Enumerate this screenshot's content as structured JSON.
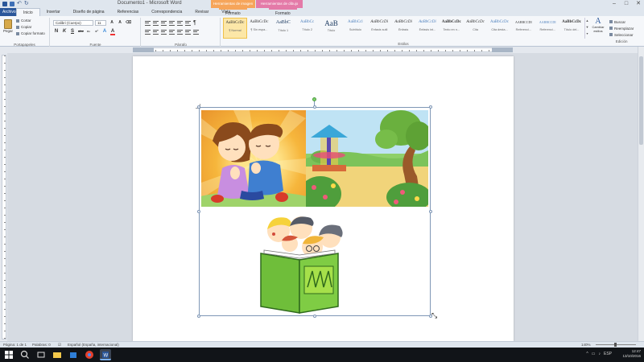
{
  "window": {
    "title": "Documento1 - Microsoft Word",
    "context_picture_tools": "Herramientas de imagen",
    "context_drawing_tools": "Herramientas de dibujo",
    "minimize": "–",
    "maximize": "□",
    "close": "✕"
  },
  "ribbon_tabs": [
    "Archivo",
    "Inicio",
    "Insertar",
    "Diseño de página",
    "Referencias",
    "Correspondencia",
    "Revisar",
    "Vista"
  ],
  "context_tabs": {
    "picture_format": "Formato",
    "drawing_format": "Formato"
  },
  "clipboard": {
    "paste": "Pegar",
    "cut": "Cortar",
    "copy": "Copiar",
    "format_painter": "Copiar formato",
    "label": "Portapapeles"
  },
  "font": {
    "name": "Calibri (Cuerpo)",
    "size": "11",
    "label": "Fuente",
    "format_buttons": [
      "N",
      "K",
      "S",
      "abc",
      "x₂",
      "x²",
      "A",
      "A"
    ]
  },
  "paragraph": {
    "label": "Párrafo"
  },
  "styles": {
    "label": "Estilos",
    "items": [
      {
        "sample": "AaBbCcDc",
        "name": "¶ Normal"
      },
      {
        "sample": "AaBbCcDc",
        "name": "¶ Sin espa..."
      },
      {
        "sample": "AaBbC",
        "name": "Título 1"
      },
      {
        "sample": "AaBbCc",
        "name": "Título 2"
      },
      {
        "sample": "AaB",
        "name": "Título"
      },
      {
        "sample": "AaBbCcl",
        "name": "Subtítulo"
      },
      {
        "sample": "AaBbCcDi",
        "name": "Énfasis sutil"
      },
      {
        "sample": "AaBbCcDi",
        "name": "Énfasis"
      },
      {
        "sample": "AaBbCcDi",
        "name": "Énfasis int..."
      },
      {
        "sample": "AaBbCcDc",
        "name": "Texto en n..."
      },
      {
        "sample": "AaBbCcDc",
        "name": "Cita"
      },
      {
        "sample": "AaBbCcDc",
        "name": "Cita desta..."
      },
      {
        "sample": "AABBCCDI",
        "name": "Referenci..."
      },
      {
        "sample": "AABBCCDI",
        "name": "Referenci..."
      },
      {
        "sample": "AaBbCcDc",
        "name": "Título del..."
      }
    ],
    "change_styles": "Cambiar estilos"
  },
  "editing": {
    "label": "Edición",
    "find": "Buscar",
    "replace": "Reemplazar",
    "select": "Seleccionar"
  },
  "statusbar": {
    "page": "Página: 1 de 1",
    "words": "Palabras: 0",
    "language": "Español (España, internacional)",
    "zoom": "140%"
  },
  "taskbar": {
    "time": "12:47",
    "date": "13/10/2016",
    "language": "ESP"
  },
  "colors": {
    "accent": "#2b579a",
    "picture_tools": "#f6a55a",
    "drawing_tools": "#e47aa8"
  }
}
